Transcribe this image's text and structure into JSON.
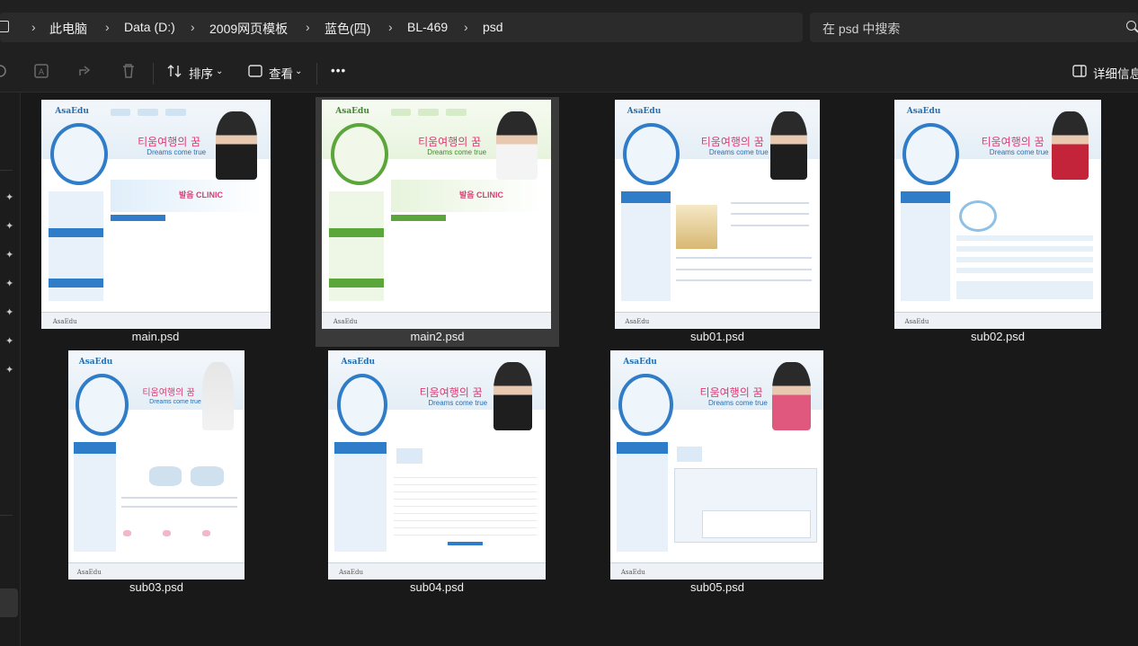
{
  "breadcrumb": [
    "此电脑",
    "Data (D:)",
    "2009网页模板",
    "蓝色(四)",
    "BL-469",
    "psd"
  ],
  "search": {
    "placeholder": "在 psd 中搜索"
  },
  "toolbar": {
    "sort_label": "排序",
    "view_label": "查看",
    "more_label": "•••",
    "details_label": "详细信息"
  },
  "files": [
    {
      "name": "main.psd",
      "selected": false
    },
    {
      "name": "main2.psd",
      "selected": true
    },
    {
      "name": "sub01.psd",
      "selected": false
    },
    {
      "name": "sub02.psd",
      "selected": false
    },
    {
      "name": "sub03.psd",
      "selected": false
    },
    {
      "name": "sub04.psd",
      "selected": false
    },
    {
      "name": "sub05.psd",
      "selected": false
    }
  ],
  "thumbnail_text": {
    "logo": "AsaEdu",
    "headline": "티움여행의 꿈",
    "tagline": "Dreams come true",
    "banner": "발음 CLINIC",
    "footer_logo": "AsaEdu"
  },
  "colors": {
    "accent_blue": "#2f7cc8",
    "accent_green": "#5aa63a",
    "headline_pink": "#d93c72"
  }
}
